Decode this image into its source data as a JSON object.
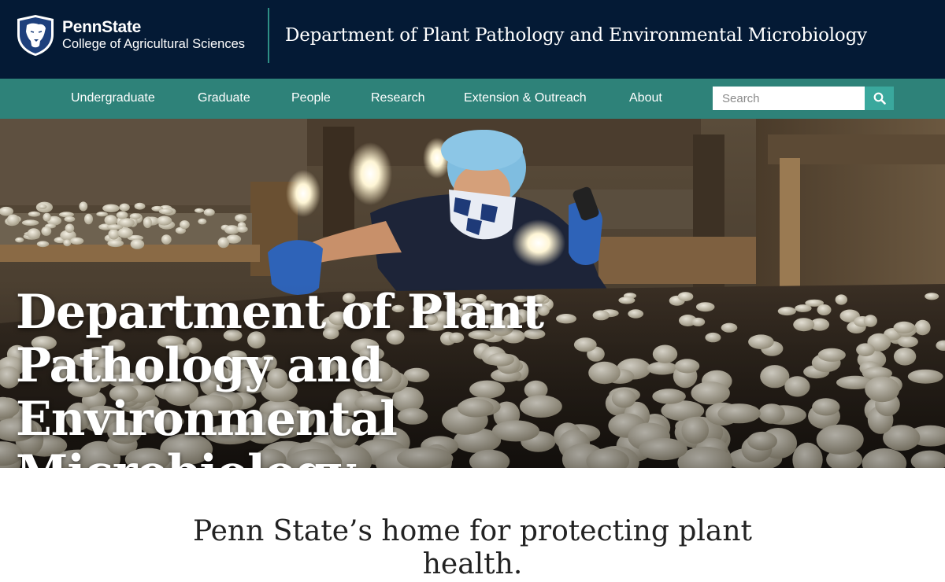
{
  "header": {
    "logo_icon": "nittany-lion-shield-icon",
    "brand_name": "PennState",
    "college_name": "College of Agricultural Sciences",
    "department_title": "Department of Plant Pathology and Environmental Microbiology",
    "colors": {
      "header_bg": "#041a35",
      "divider": "#2e8f86"
    }
  },
  "nav": {
    "items": [
      {
        "label": "Undergraduate"
      },
      {
        "label": "Graduate"
      },
      {
        "label": "People"
      },
      {
        "label": "Research"
      },
      {
        "label": "Extension & Outreach"
      },
      {
        "label": "About"
      }
    ],
    "search": {
      "placeholder": "Search",
      "value": "",
      "button_icon": "search-icon"
    },
    "colors": {
      "nav_bg": "#2e8279",
      "search_button": "#3aa89d"
    }
  },
  "hero": {
    "title": "Department of Plant Pathology and Environmental Microbiology",
    "image_alt": "Researcher in hairnet and mask inspecting mushroom beds with a flashlight"
  },
  "intro": {
    "tagline": "Penn State’s home for protecting plant health."
  }
}
